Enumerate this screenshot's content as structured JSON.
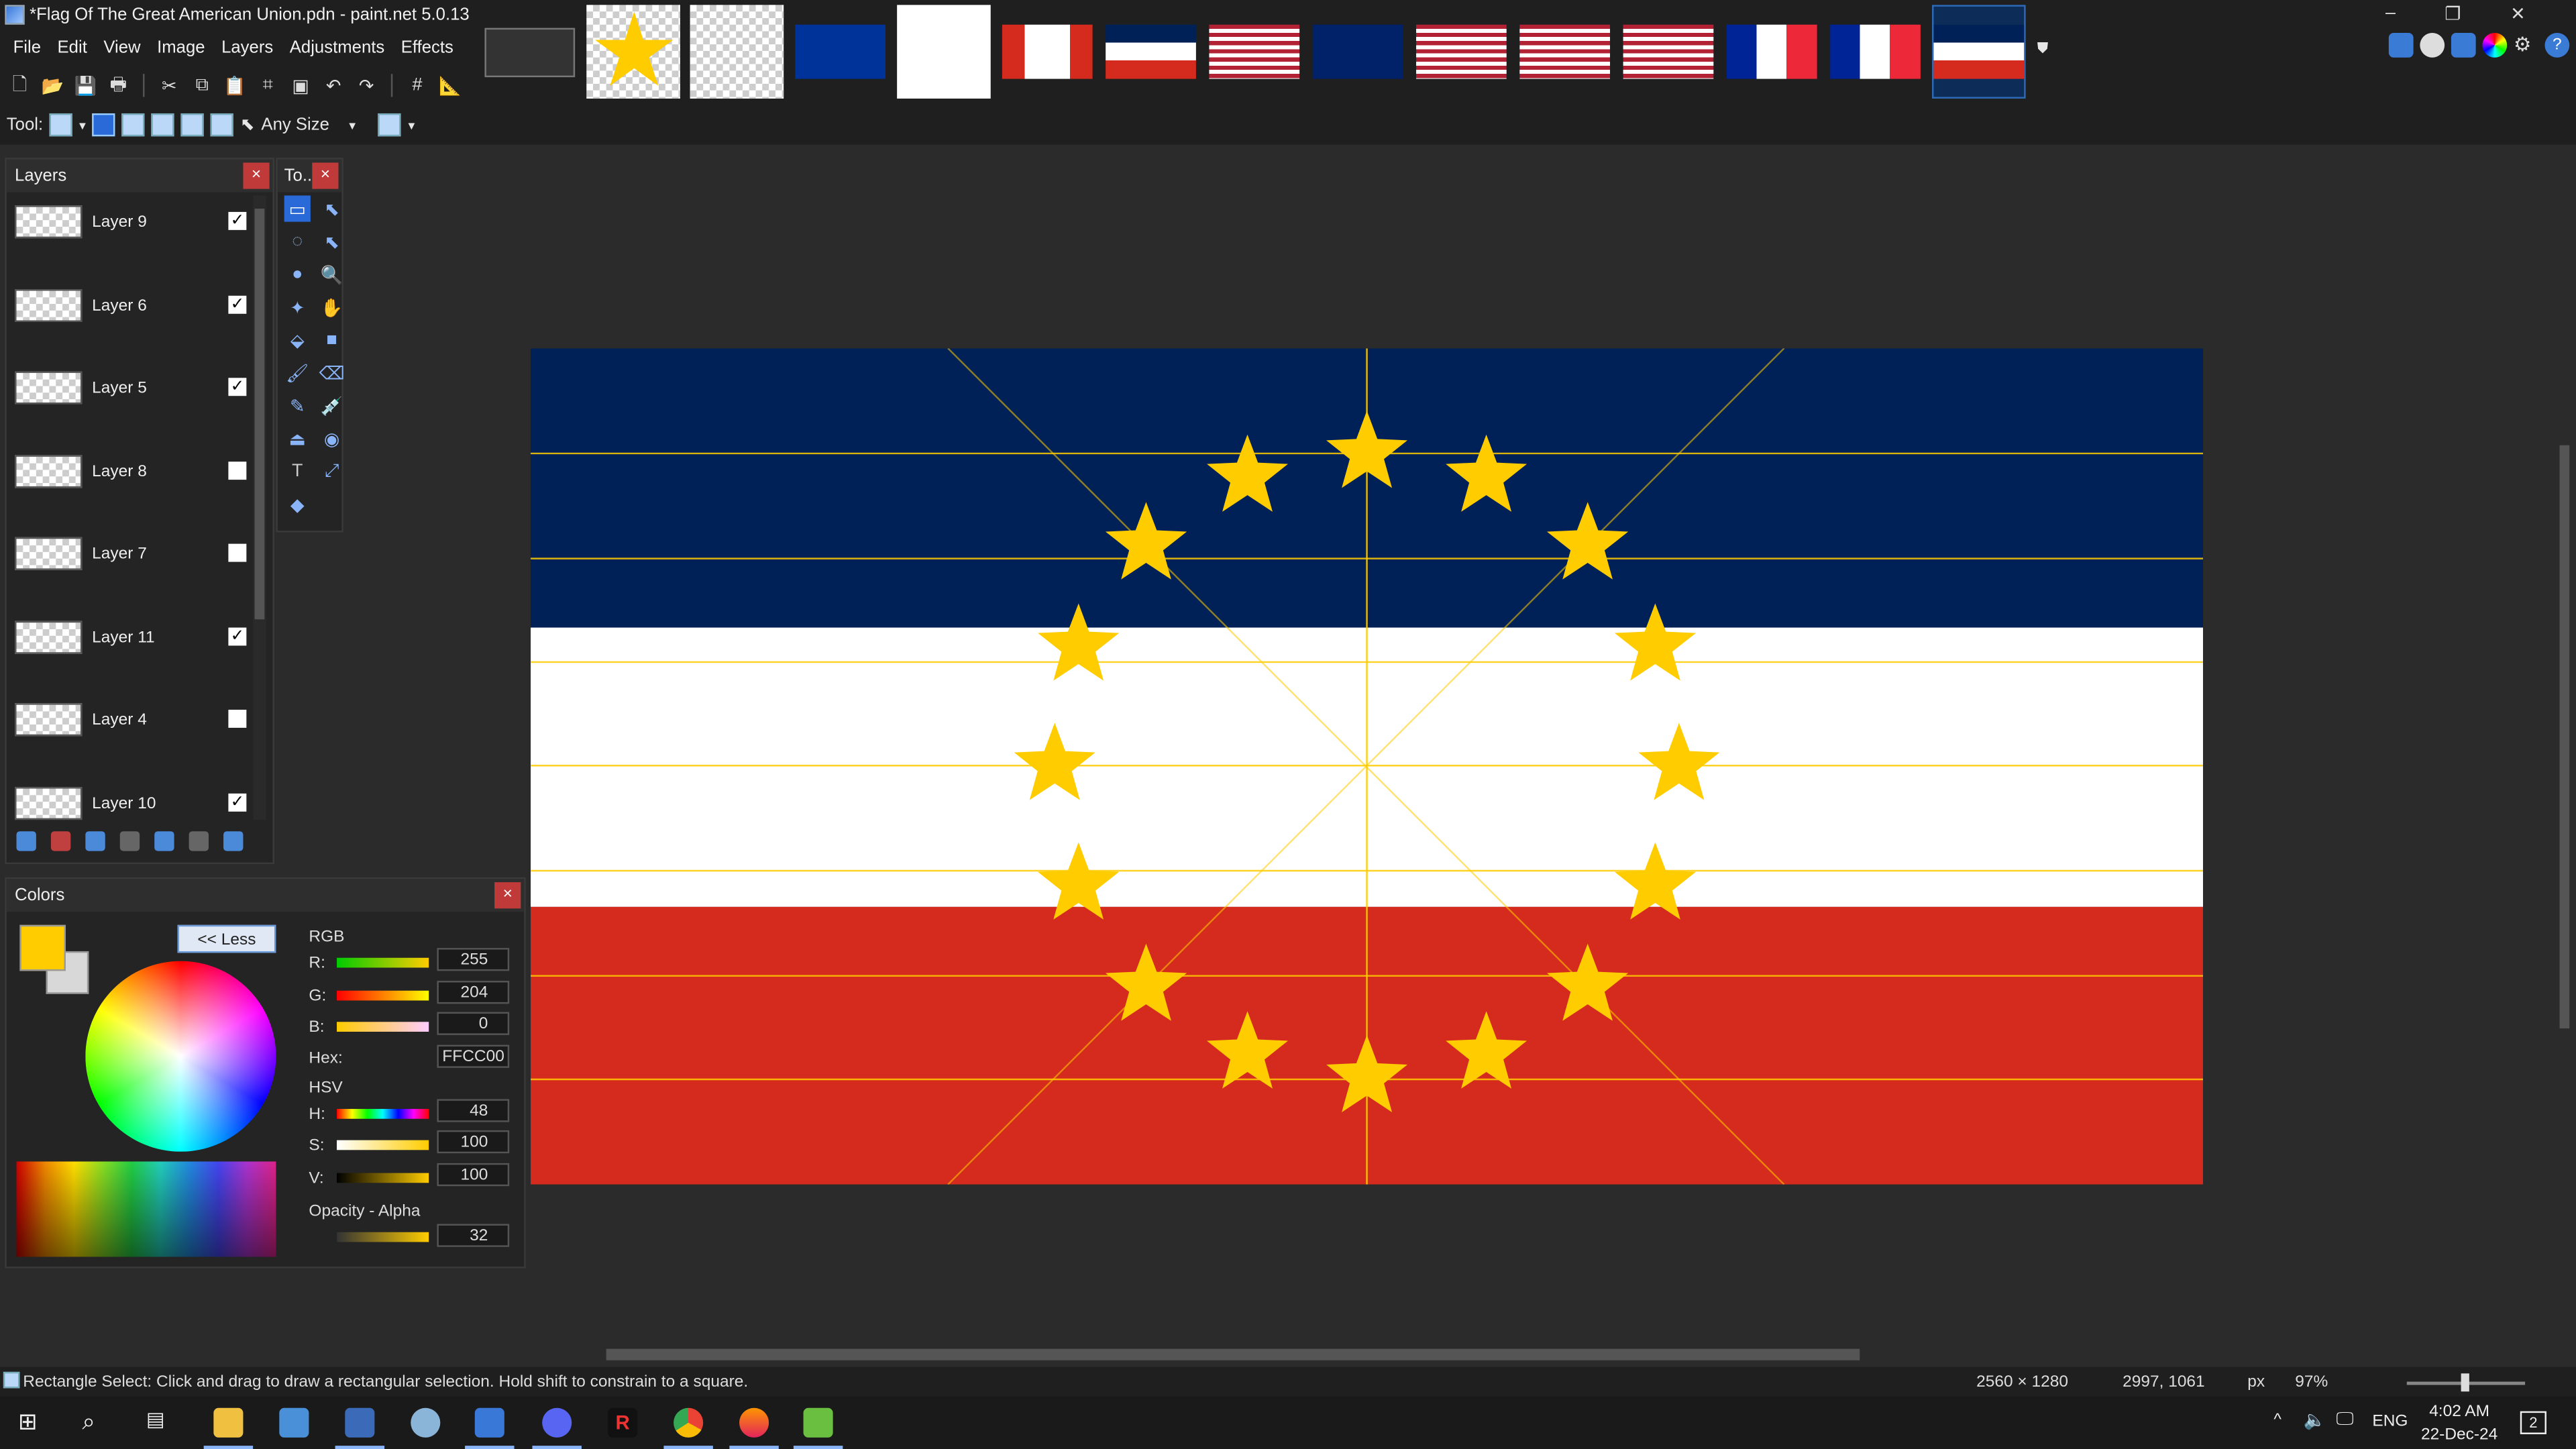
{
  "window": {
    "title": "*Flag Of The Great American Union.pdn - paint.net 5.0.13",
    "controls": [
      "–",
      "❐",
      "✕"
    ]
  },
  "menu": [
    "File",
    "Edit",
    "View",
    "Image",
    "Layers",
    "Adjustments",
    "Effects"
  ],
  "toolbar": {
    "tool_label": "Tool:",
    "size_mode": "Any Size"
  },
  "layers_panel": {
    "title": "Layers",
    "layers": [
      {
        "name": "Layer 9",
        "visible": true
      },
      {
        "name": "Layer 6",
        "visible": true
      },
      {
        "name": "Layer 5",
        "visible": true
      },
      {
        "name": "Layer 8",
        "visible": false
      },
      {
        "name": "Layer 7",
        "visible": false
      },
      {
        "name": "Layer 11",
        "visible": true
      },
      {
        "name": "Layer 4",
        "visible": false
      },
      {
        "name": "Layer 10",
        "visible": true
      }
    ]
  },
  "tools_panel": {
    "title": "To..."
  },
  "colors_panel": {
    "title": "Colors",
    "less_button": "<< Less",
    "rgb_label": "RGB",
    "hsv_label": "HSV",
    "r_label": "R:",
    "r_value": "255",
    "g_label": "G:",
    "g_value": "204",
    "b_label": "B:",
    "b_value": "0",
    "hex_label": "Hex:",
    "hex_value": "FFCC00",
    "h_label": "H:",
    "h_value": "48",
    "s_label": "S:",
    "s_value": "100",
    "v_label": "V:",
    "v_value": "100",
    "alpha_label": "Opacity - Alpha",
    "alpha_value": "32",
    "primary_color": "#ffcc00"
  },
  "flag": {
    "colors": {
      "blue": "#002157",
      "white": "#ffffff",
      "red": "#d52b1e",
      "star": "#ffcc00",
      "guide": "#ffcc00"
    },
    "star_count": 16
  },
  "status": {
    "hint": "Rectangle Select: Click and drag to draw a rectangular selection. Hold shift to constrain to a square.",
    "image_size": "2560 × 1280",
    "cursor": "2997, 1061",
    "units": "px",
    "zoom": "97%"
  },
  "taskbar": {
    "lang": "ENG",
    "time": "4:02 AM",
    "date": "22-Dec-24",
    "notifications": "2"
  }
}
